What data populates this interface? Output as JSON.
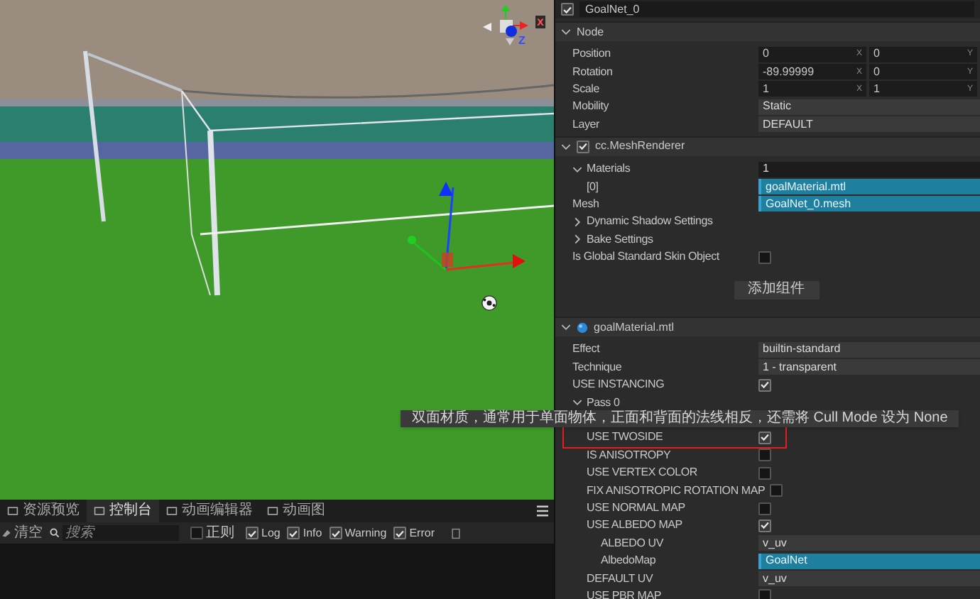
{
  "scene": {
    "view_gizmo_axes": [
      "x",
      "Z"
    ]
  },
  "console": {
    "tabs": [
      {
        "label": "资源预览",
        "selected": false
      },
      {
        "label": "控制台",
        "selected": true
      },
      {
        "label": "动画编辑器",
        "selected": false
      },
      {
        "label": "动画图",
        "selected": false
      }
    ],
    "clear_label": "清空",
    "search": {
      "placeholder": "搜索"
    },
    "filters": [
      {
        "label": "正则",
        "checked": false
      },
      {
        "label": "Log",
        "checked": true
      },
      {
        "label": "Info",
        "checked": true
      },
      {
        "label": "Warning",
        "checked": true
      },
      {
        "label": "Error",
        "checked": true
      }
    ]
  },
  "inspector": {
    "node_name": "GoalNet_0",
    "node_enabled": true,
    "sections": [
      {
        "title": "Node",
        "kind": "node",
        "expanded": true,
        "rows": [
          {
            "kind": "vector",
            "label": "Position",
            "values": [
              {
                "value": "0",
                "axis": "X"
              },
              {
                "value": "0",
                "axis": "Y"
              }
            ]
          },
          {
            "kind": "vector",
            "label": "Rotation",
            "values": [
              {
                "value": "-89.99999",
                "axis": "X"
              },
              {
                "value": "0",
                "axis": "Y"
              }
            ]
          },
          {
            "kind": "vector",
            "label": "Scale",
            "values": [
              {
                "value": "1",
                "axis": "X"
              },
              {
                "value": "1",
                "axis": "Y"
              }
            ]
          },
          {
            "kind": "select",
            "label": "Mobility",
            "value": "Static"
          },
          {
            "kind": "select",
            "label": "Layer",
            "value": "DEFAULT"
          }
        ]
      },
      {
        "title": "cc.MeshRenderer",
        "kind": "component",
        "enabled": true,
        "expanded": true,
        "rows": [
          {
            "kind": "number",
            "label": "Materials",
            "value": "1",
            "expanded": true,
            "children": [
              {
                "kind": "asset",
                "label": "[0]",
                "value": "goalMaterial.mtl"
              }
            ]
          },
          {
            "kind": "asset",
            "label": "Mesh",
            "value": "GoalNet_0.mesh"
          },
          {
            "kind": "fold",
            "label": "Dynamic Shadow Settings",
            "expanded": false
          },
          {
            "kind": "fold",
            "label": "Bake Settings",
            "expanded": false
          },
          {
            "kind": "check",
            "label": "Is Global Standard Skin Object",
            "checked": false
          },
          {
            "kind": "button",
            "label": "添加组件"
          }
        ]
      },
      {
        "title": "goalMaterial.mtl",
        "kind": "material",
        "expanded": true,
        "rows": [
          {
            "kind": "select",
            "label": "Effect",
            "value": "builtin-standard"
          },
          {
            "kind": "select",
            "label": "Technique",
            "value": "1 - transparent"
          },
          {
            "kind": "check",
            "label": "USE INSTANCING",
            "checked": true
          },
          {
            "kind": "fold",
            "label": "Pass 0",
            "expanded": true,
            "children": [
              {
                "kind": "hidden"
              },
              {
                "kind": "check",
                "label": "USE TWOSIDE",
                "checked": true,
                "highlighted": true
              },
              {
                "kind": "check",
                "label": "IS ANISOTROPY",
                "checked": false
              },
              {
                "kind": "check",
                "label": "USE VERTEX COLOR",
                "checked": false
              },
              {
                "kind": "check",
                "label": "FIX ANISOTROPIC ROTATION MAP",
                "checked": false
              },
              {
                "kind": "check",
                "label": "USE NORMAL MAP",
                "checked": false
              },
              {
                "kind": "check",
                "label": "USE ALBEDO MAP",
                "checked": true,
                "children": [
                  {
                    "kind": "select",
                    "label": "ALBEDO UV",
                    "value": "v_uv"
                  },
                  {
                    "kind": "asset",
                    "label": "AlbedoMap",
                    "value": "GoalNet"
                  }
                ]
              },
              {
                "kind": "select",
                "label": "DEFAULT UV",
                "value": "v_uv"
              },
              {
                "kind": "check",
                "label": "USE PBR MAP",
                "checked": false
              }
            ]
          }
        ]
      }
    ]
  },
  "tooltip": "双面材质，通常用于单面物体，正面和背面的法线相反，还需将 Cull Mode 设为 None"
}
